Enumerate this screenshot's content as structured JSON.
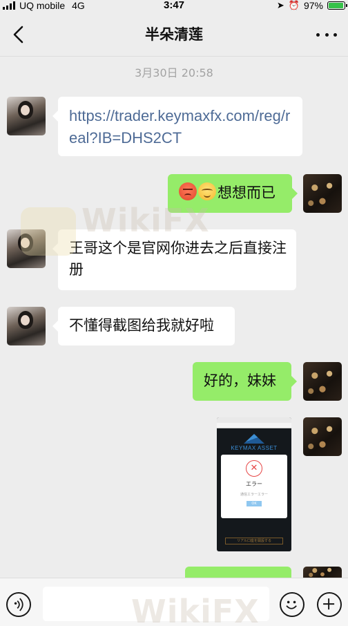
{
  "status_bar": {
    "carrier": "UQ mobile",
    "network": "4G",
    "time": "3:47",
    "battery": "97%"
  },
  "nav": {
    "title": "半朵清莲"
  },
  "chat": {
    "timestamp": "3月30日 20:58",
    "messages": [
      {
        "side": "left",
        "text": "https://trader.keymaxfx.com/reg/real?IB=DHS2CT"
      },
      {
        "side": "right",
        "text": "想想而已",
        "emoji": [
          "angry-emoji",
          "smile-emoji"
        ]
      },
      {
        "side": "left",
        "text": "王哥这个是官网你进去之后直接注册"
      },
      {
        "side": "left",
        "text": "不懂得截图给我就好啦"
      },
      {
        "side": "right",
        "text": "好的，妹妹"
      }
    ],
    "screenshot": {
      "brand": "KEYMAX ASSET",
      "dialog_title": "エラー",
      "dialog_message": "通信エラーエラー",
      "ok_label": "OK",
      "bottom_button": "リアル口座を開設する"
    }
  },
  "watermark": "WikiFX",
  "colors": {
    "sent_bubble": "#95ec69",
    "received_bubble": "#ffffff",
    "link": "#4e6b96",
    "background": "#ededed"
  }
}
